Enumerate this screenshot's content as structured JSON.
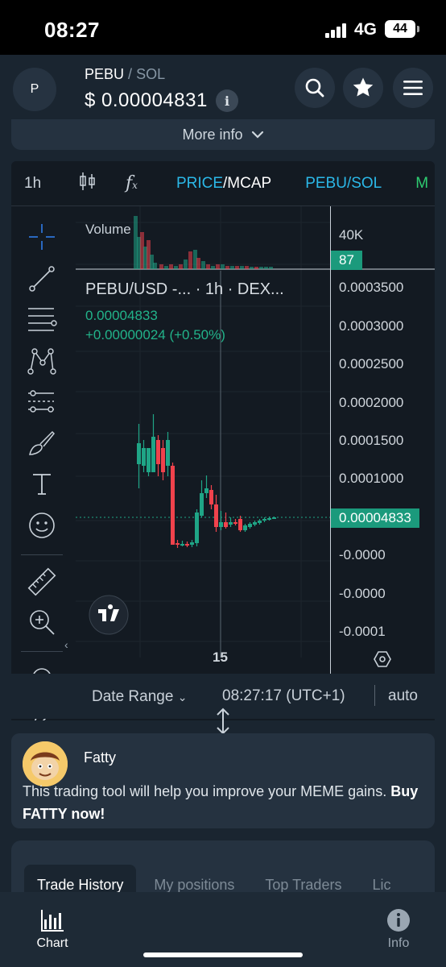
{
  "status_bar": {
    "time": "08:27",
    "network": "4G",
    "battery": "44"
  },
  "header": {
    "avatar_letter": "P",
    "base_symbol": "PEBU",
    "separator": "/",
    "quote_symbol": "SOL",
    "price": "$ 0.00004831",
    "info_icon": "i"
  },
  "more_info": {
    "label": "More info"
  },
  "chart_toolbar": {
    "interval": "1h",
    "price_label": "PRICE",
    "mcap_label": "/MCAP",
    "pair_label": "PEBU/SOL",
    "overflow_label": "M"
  },
  "chart": {
    "volume_label": "Volume",
    "volume_axis": "40K",
    "volume_badge": "87",
    "legend_title": "PEBU/USD -... · 1h · DEX...",
    "legend_price": "0.00004833",
    "legend_change": "+0.00000024 (+0.50%)",
    "y_labels": [
      "0.0003500",
      "0.0003000",
      "0.0002500",
      "0.0002000",
      "0.0001500",
      "0.0001000",
      "-0.0000",
      "-0.0000",
      "-0.0001"
    ],
    "current_price_badge": "0.00004833",
    "x_tick": "15",
    "colors": {
      "up": "#1fa586",
      "down": "#f0424c",
      "badge": "#1b9a7c",
      "accent": "#2bb8e8"
    }
  },
  "chart_footer": {
    "date_range": "Date Range",
    "clock": "08:27:17 (UTC+1)",
    "scale": "auto"
  },
  "ad": {
    "name": "Fatty",
    "text_plain": "This trading tool will help you improve your MEME gains. ",
    "text_bold": "Buy FATTY now!"
  },
  "tabs": [
    "Trade History",
    "My positions",
    "Top Traders",
    "Lic"
  ],
  "bottom_nav": {
    "chart_label": "Chart",
    "info_label": "Info"
  }
}
